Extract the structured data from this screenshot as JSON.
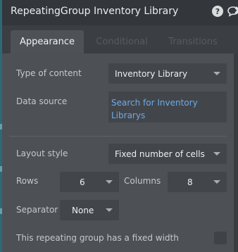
{
  "window": {
    "title": "RepeatingGroup Inventory Library",
    "icons": [
      "help-icon",
      "chat-icon",
      "close-icon"
    ]
  },
  "tabs": {
    "items": [
      {
        "label": "Appearance",
        "active": true
      },
      {
        "label": "Conditional",
        "active": false
      },
      {
        "label": "Transitions",
        "active": false
      }
    ]
  },
  "fields": {
    "type_of_content": {
      "label": "Type of content",
      "value": "Inventory Library"
    },
    "data_source": {
      "label": "Data source",
      "value": "Search for Inventory Librarys"
    },
    "layout_style": {
      "label": "Layout style",
      "value": "Fixed number of cells"
    },
    "rows": {
      "label": "Rows",
      "value": "6"
    },
    "columns": {
      "label": "Columns",
      "value": "8"
    },
    "separator": {
      "label": "Separator",
      "value": "None"
    },
    "fixed_width": {
      "label": "This repeating group has a fixed width",
      "checked": false
    }
  },
  "colors": {
    "link": "#6fa9e8",
    "panel": "#4d5155",
    "accent_edge": "#2e6a76"
  }
}
